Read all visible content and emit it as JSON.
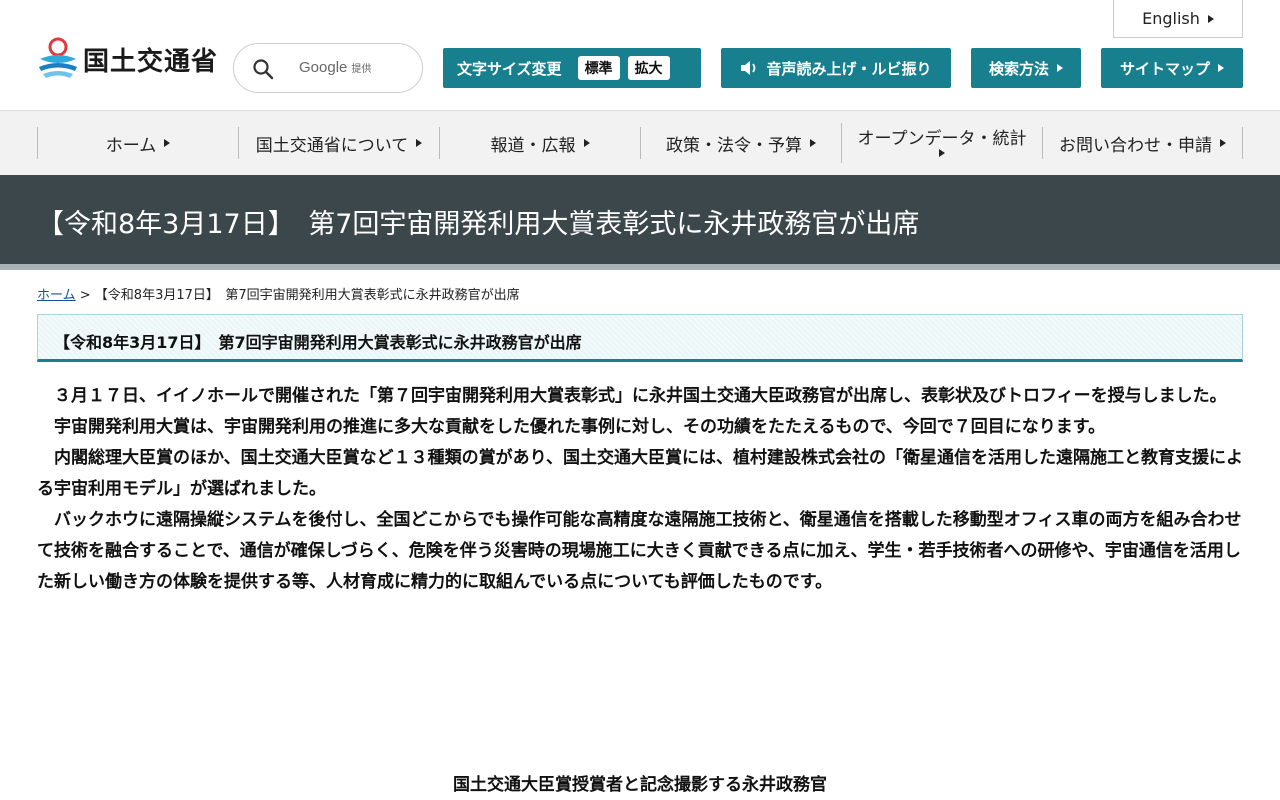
{
  "header": {
    "logo_text": "国土交通省",
    "search": {
      "brand": "Google",
      "sub": "提供"
    },
    "english_label": "English",
    "font_size": {
      "label": "文字サイズ変更",
      "options": [
        "標準",
        "拡大"
      ]
    },
    "voice_label": "音声読み上げ・ルビ振り",
    "search_method_label": "検索方法",
    "sitemap_label": "サイトマップ"
  },
  "nav": {
    "items": [
      {
        "line1": "ホーム",
        "line2": ""
      },
      {
        "line1": "国土交通省について",
        "line2": ""
      },
      {
        "line1": "報道・広報",
        "line2": ""
      },
      {
        "line1": "政策・法令・予算",
        "line2": ""
      },
      {
        "line1": "オープンデータ・統計",
        "line2": ""
      },
      {
        "line1": "お問い合わせ・申請",
        "line2": ""
      }
    ]
  },
  "page": {
    "title": "【令和8年3月17日】　第7回宇宙開発利用大賞表彰式に永井政務官が出席",
    "breadcrumb": {
      "home": "ホーム",
      "sep": " > ",
      "current": "【令和8年3月17日】　第7回宇宙開発利用大賞表彰式に永井政務官が出席"
    },
    "subtitle": "【令和8年3月17日】　第7回宇宙開発利用大賞表彰式に永井政務官が出席",
    "paragraphs": [
      "　３月１７日、イイノホールで開催された「第７回宇宙開発利用大賞表彰式」に永井国土交通大臣政務官が出席し、表彰状及びトロフィーを授与しました。",
      "　宇宙開発利用大賞は、宇宙開発利用の推進に多大な貢献をした優れた事例に対し、その功績をたたえるもので、今回で７回目になります。",
      "　内閣総理大臣賞のほか、国土交通大臣賞など１３種類の賞があり、国土交通大臣賞には、植村建設株式会社の「衛星通信を活用した遠隔施工と教育支援による宇宙利用モデル」が選ばれました。",
      "　バックホウに遠隔操縦システムを後付し、全国どこからでも操作可能な高精度な遠隔施工技術と、衛星通信を搭載した移動型オフィス車の両方を組み合わせて技術を融合することで、通信が確保しづらく、危険を伴う災害時の現場施工に大きく貢献できる点に加え、学生・若手技術者への研修や、宇宙通信を活用した新しい働き方の体験を提供する等、人材育成に精力的に取組んでいる点についても評価したものです。"
    ],
    "caption": "国土交通大臣賞授賞者と記念撮影する永井政務官"
  },
  "colors": {
    "accent": "#177f8e",
    "titlebar": "#3c474c",
    "nav_bg": "#f2f2f2"
  }
}
